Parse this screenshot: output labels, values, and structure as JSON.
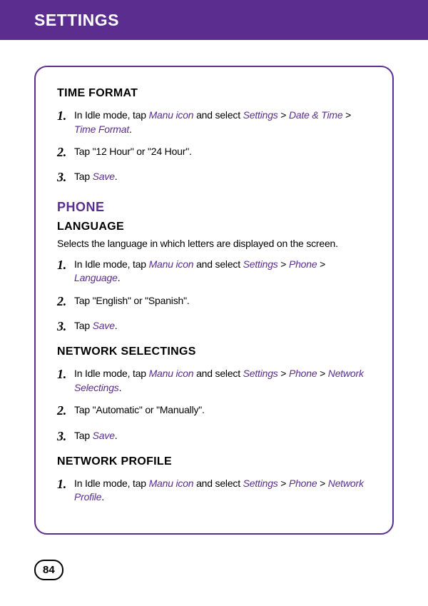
{
  "header": {
    "title": "SETTINGS"
  },
  "pageNumber": "84",
  "sections": {
    "timeFormat": {
      "heading": "TIME FORMAT",
      "step1_pre": "In Idle mode, tap ",
      "step1_t1": "Manu icon",
      "step1_mid1": " and select ",
      "step1_t2": "Settings",
      "step1_gt1": " > ",
      "step1_t3": "Date & Time",
      "step1_gt2": " > ",
      "step1_t4": "Time Format",
      "step1_end": ".",
      "step2": "Tap \"12 Hour\" or \"24 Hour\".",
      "step3_pre": "Tap ",
      "step3_t": "Save",
      "step3_end": "."
    },
    "phone": {
      "heading": "PHONE"
    },
    "language": {
      "heading": "LANGUAGE",
      "description": "Selects the language in which letters are displayed on the screen.",
      "step1_pre": "In Idle mode, tap ",
      "step1_t1": "Manu icon",
      "step1_mid1": " and select ",
      "step1_t2": "Settings",
      "step1_gt1": " > ",
      "step1_t3": "Phone",
      "step1_gt2": " > ",
      "step1_t4": "Language",
      "step1_end": ".",
      "step2": "Tap \"English\" or \"Spanish\".",
      "step3_pre": "Tap ",
      "step3_t": "Save",
      "step3_end": "."
    },
    "networkSelectings": {
      "heading": "NETWORK SELECTINGS",
      "step1_pre": "In Idle mode, tap ",
      "step1_t1": "Manu icon",
      "step1_mid1": " and select ",
      "step1_t2": "Settings",
      "step1_gt1": " > ",
      "step1_t3": "Phone",
      "step1_gt2": " > ",
      "step1_t4": "Network Selectings",
      "step1_end": ".",
      "step2": "Tap \"Automatic\" or \"Manually\".",
      "step3_pre": "Tap ",
      "step3_t": "Save",
      "step3_end": "."
    },
    "networkProfile": {
      "heading": "NETWORK PROFILE",
      "step1_pre": "In Idle mode, tap ",
      "step1_t1": "Manu icon",
      "step1_mid1": " and select ",
      "step1_t2": "Settings",
      "step1_gt1": " > ",
      "step1_t3": "Phone",
      "step1_gt2": " > ",
      "step1_t4": "Network Profile",
      "step1_end": "."
    }
  },
  "numbers": {
    "n1": "1.",
    "n2": "2.",
    "n3": "3."
  }
}
